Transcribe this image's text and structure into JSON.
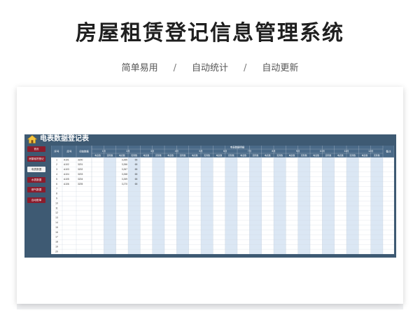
{
  "page": {
    "title": "房屋租赁登记信息管理系统",
    "subtitle_items": [
      "简单易用",
      "自动统计",
      "自动更新"
    ],
    "subtitle_separator": "/"
  },
  "app": {
    "title": "电表数据登记表",
    "nav": [
      {
        "label": "首页",
        "active": false
      },
      {
        "label": "房屋租赁登记",
        "active": false
      },
      {
        "label": "电表数据",
        "active": true
      },
      {
        "label": "水表数据",
        "active": false
      },
      {
        "label": "燃气数据",
        "active": false
      },
      {
        "label": "自动账单",
        "active": false
      }
    ]
  },
  "table": {
    "group_header": "电表数据明细",
    "col_seq": "序号",
    "col_room": "房号",
    "col_initial": "初始数据",
    "col_remark": "备注",
    "months": [
      "1月",
      "2月",
      "3月",
      "4月",
      "5月",
      "6月",
      "7月",
      "8月",
      "9月",
      "10月",
      "11月",
      "12月"
    ],
    "sub_reading": "电表数",
    "sub_actual": "实际数",
    "rows": [
      {
        "seq": "1",
        "room": "A101",
        "initial": "3200",
        "m1_reading": "",
        "m1_actual": "",
        "m2_reading": "3,265",
        "m2_actual": "65"
      },
      {
        "seq": "2",
        "room": "A102",
        "initial": "3201",
        "m1_reading": "",
        "m1_actual": "",
        "m2_reading": "3,266",
        "m2_actual": "65"
      },
      {
        "seq": "3",
        "room": "A103",
        "initial": "3202",
        "m1_reading": "",
        "m1_actual": "",
        "m2_reading": "3,267",
        "m2_actual": "65"
      },
      {
        "seq": "4",
        "room": "A104",
        "initial": "3203",
        "m1_reading": "",
        "m1_actual": "",
        "m2_reading": "3,268",
        "m2_actual": "65"
      },
      {
        "seq": "5",
        "room": "A105",
        "initial": "3204",
        "m1_reading": "",
        "m1_actual": "",
        "m2_reading": "3,269",
        "m2_actual": "65"
      },
      {
        "seq": "6",
        "room": "A106",
        "initial": "3205",
        "m1_reading": "",
        "m1_actual": "",
        "m2_reading": "3,270",
        "m2_actual": "65"
      },
      {
        "seq": "7"
      },
      {
        "seq": "8"
      },
      {
        "seq": "9"
      },
      {
        "seq": "10"
      },
      {
        "seq": "11"
      },
      {
        "seq": "12"
      },
      {
        "seq": "13"
      },
      {
        "seq": "14"
      },
      {
        "seq": "15"
      },
      {
        "seq": "16"
      },
      {
        "seq": "17"
      },
      {
        "seq": "18"
      },
      {
        "seq": "19"
      },
      {
        "seq": "20"
      }
    ]
  },
  "colors": {
    "app_bg": "#3e5a73",
    "header_bg": "#4a6a88",
    "nav_bg": "#8b1c2c",
    "light_col": "#dbe7f4"
  }
}
